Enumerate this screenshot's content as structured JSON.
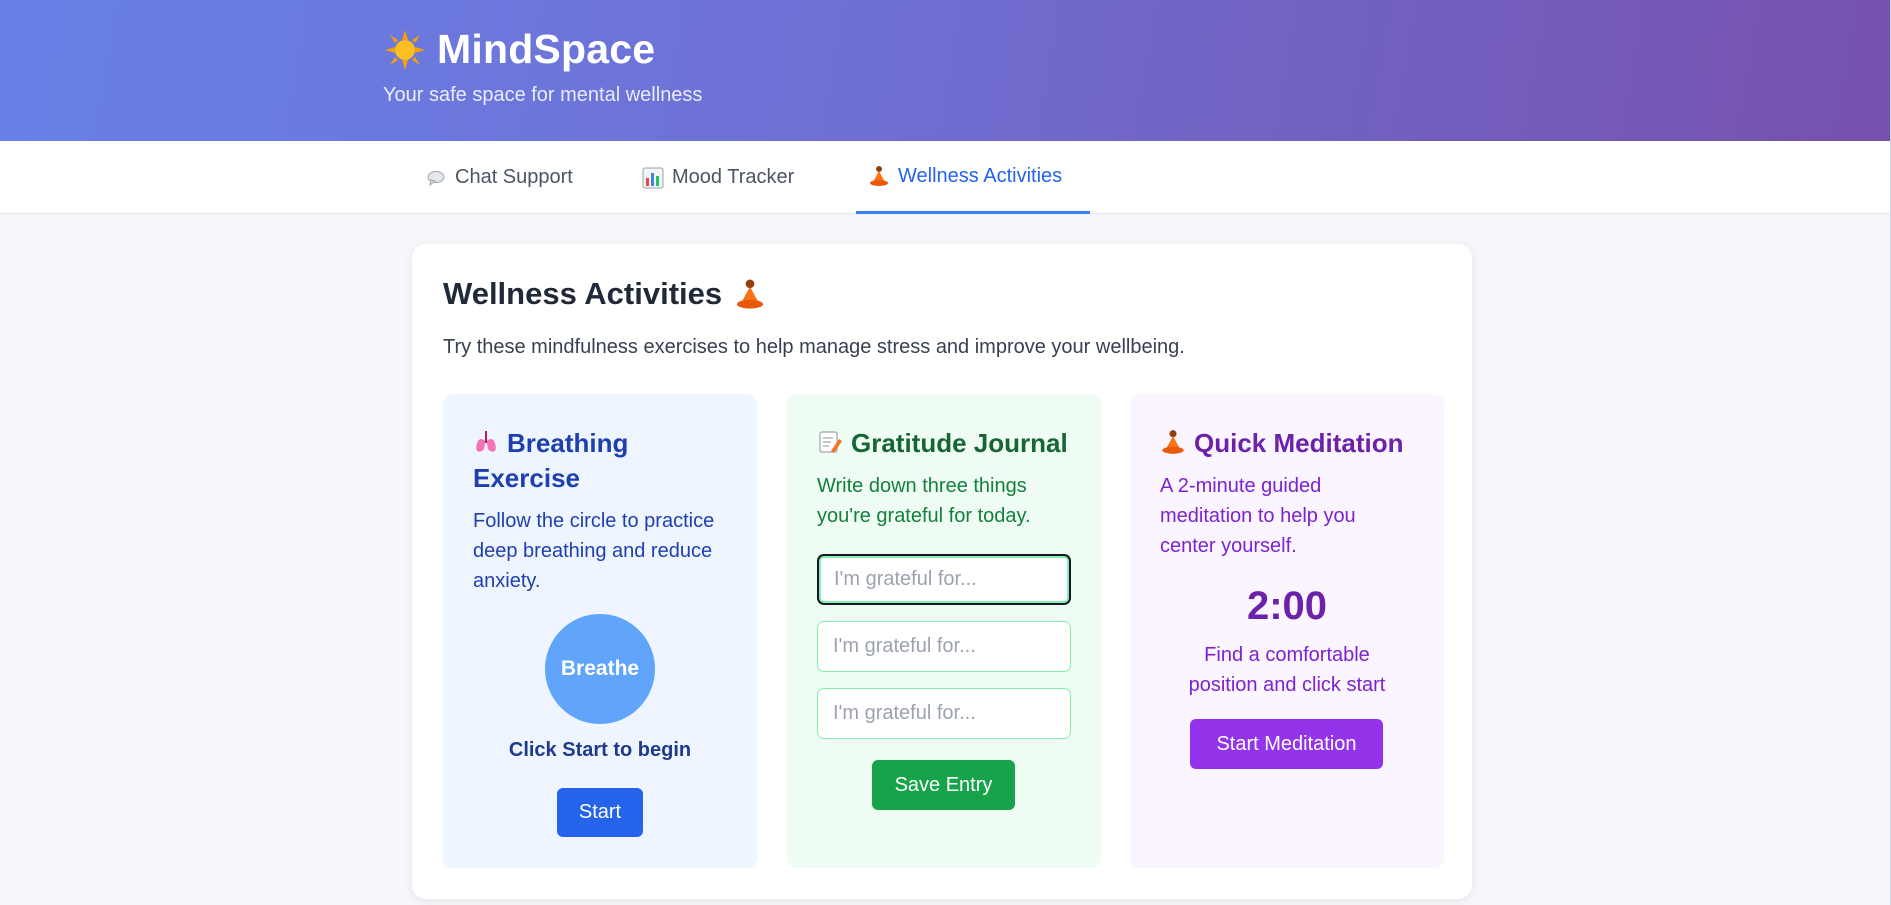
{
  "app": {
    "title": "MindSpace",
    "subtitle": "Your safe space for mental wellness",
    "brand_icon": "sun-icon"
  },
  "nav": {
    "tabs": [
      {
        "label": "Chat Support",
        "icon": "speech-bubble-icon",
        "active": false
      },
      {
        "label": "Mood Tracker",
        "icon": "bar-chart-icon",
        "active": false
      },
      {
        "label": "Wellness Activities",
        "icon": "meditation-icon",
        "active": true
      }
    ]
  },
  "main": {
    "title": "Wellness Activities",
    "description": "Try these mindfulness exercises to help manage stress and improve your wellbeing.",
    "breathing": {
      "title": "Breathing Exercise",
      "description": "Follow the circle to practice deep breathing and reduce anxiety.",
      "circle_label": "Breathe",
      "status": "Click Start to begin",
      "button_label": "Start"
    },
    "gratitude": {
      "title": "Gratitude Journal",
      "description": "Write down three things you're grateful for today.",
      "placeholder": "I'm grateful for...",
      "entries": [
        "",
        "",
        ""
      ],
      "button_label": "Save Entry"
    },
    "meditation": {
      "title": "Quick Meditation",
      "description": "A 2-minute guided meditation to help you center yourself.",
      "timer": "2:00",
      "hint": "Find a comfortable position and click start",
      "button_label": "Start Meditation"
    }
  },
  "colors": {
    "header_gradient_start": "#6781e8",
    "header_gradient_end": "#7651ad",
    "active_tab": "#2563eb",
    "breathing_accent": "#2563eb",
    "gratitude_accent": "#16a34a",
    "meditation_accent": "#9333ea"
  }
}
